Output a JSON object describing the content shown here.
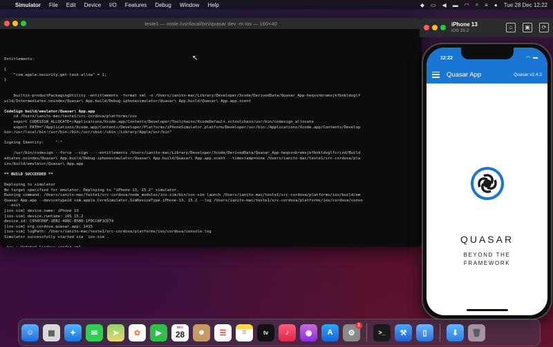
{
  "menubar": {
    "app_name": "Simulator",
    "items": [
      "File",
      "Edit",
      "Device",
      "I/O",
      "Features",
      "Debug",
      "Window",
      "Help"
    ],
    "clock": "Tue 28 Dec  12:22"
  },
  "terminal": {
    "title": "teste1 — node /usr/local/bin/quasar dev -m ios — 160×40",
    "lines": [
      "Entitlements:",
      "",
      "{",
      "    \"com.apple.security.get-task-allow\" = 1;",
      "}",
      "",
      "",
      "    builtin-productPackagingUtility -entitlements -format xml -o /Users/ianito-mac/Library/Developer/Xcode/DerivedData/Quasar_App-heqxxnbremsjkfbnkldvglf",
      "uild/Intermediates.noindex/Quasar\\ App.build/Debug-iphonesimulator/Quasar\\ App.build/Quasar\\ App.app.xcent",
      "",
      "CodeSign build/emulator/Quasar\\ App.app",
      "    cd /Users/ianito-mac/teste1/src-cordova/platforms/ios",
      "    export CODESIGN_ALLOCATE=/Applications/Xcode.app/Contents/Developer/Toolchains/XcodeDefault.xctoolchain/usr/bin/codesign_allocate",
      "    export PATH=\"/Applications/Xcode.app/Contents/Developer/Platforms/iPhoneSimulator.platform/Developer/usr/bin:/Applications/Xcode.app/Contents/Develop",
      "bin:/usr/local/bin:/usr/bin:/bin:/usr/sbin:/sbin:/Library/Apple/usr/bin\"",
      "",
      "Signing Identity:     \"-\"",
      "",
      "    /usr/bin/codesign --force --sign - --entitlements /Users/ianito-mac/Library/Developer/Xcode/DerivedData/Quasar_App-heqxxnbremsjkfbnkldvglfcrizd/Build",
      "ediates.noindex/Quasar\\ App.build/Debug-iphonesimulator/Quasar\\ App.build/Quasar\\ App.app.xcent --timestamp=none /Users/ianito-mac/teste1/src-cordova/pla",
      "ios/build/emulator/Quasar\\ App.app",
      "",
      "** BUILD SUCCEEDED **",
      "",
      "Deploying to simulator",
      "No target specified for emulator. Deploying to \"iPhone-13, 15.2\" simulator.",
      "Running command: /Users/ianito-mac/teste1/src-cordova/node_modules/ios-sim/bin/ios-sim launch /Users/ianito-mac/teste1/src-cordova/platforms/ios/build/em",
      "Quasar App.app --devicetypeid com.apple.CoreSimulator.SimDeviceType.iPhone-13, 15.2 --log /Users/ianito-mac/teste1/src-cordova/platforms/ios/cordova/conso",
      " --exit",
      "[ios-sim] device.name: iPhone 13",
      "[ios-sim] device.runtime: iOS 15.2",
      "device.id: C950CD8F-1EB2-498C-B5B0-1FDCC8F1CD74",
      "[ios-sim] org.cordova.quasar.app: 1415",
      "[ios-sim] logPath: /Users/ianito-mac/teste1/src-cordova/platforms/ios/cordova/console.log",
      "Simulator successfully started via `ios-sim`.",
      ""
    ],
    "last_tag": " App •",
    "last_text": " Updated Cordova config.xml"
  },
  "simulator": {
    "device_name": "iPhone 13",
    "os_version": "iOS 15.2"
  },
  "phone": {
    "time": "12:22",
    "app_title": "Quasar App",
    "app_version": "Quasar v2.4.2",
    "wordmark": "QUASAR",
    "tagline_line1": "BEYOND THE",
    "tagline_line2": "FRAMEWORK",
    "brand_color": "#1976D2"
  },
  "dock": {
    "calendar_month": "DEC",
    "calendar_day": "28",
    "settings_badge": "2",
    "apps": [
      "finder",
      "launchpad",
      "safari",
      "messages",
      "maps",
      "photos",
      "facetime",
      "calendar",
      "contacts",
      "reminders",
      "notes",
      "tv",
      "music",
      "podcasts",
      "app-store",
      "system-preferences",
      "terminal",
      "xcode",
      "simulator",
      "downloads",
      "trash"
    ]
  }
}
